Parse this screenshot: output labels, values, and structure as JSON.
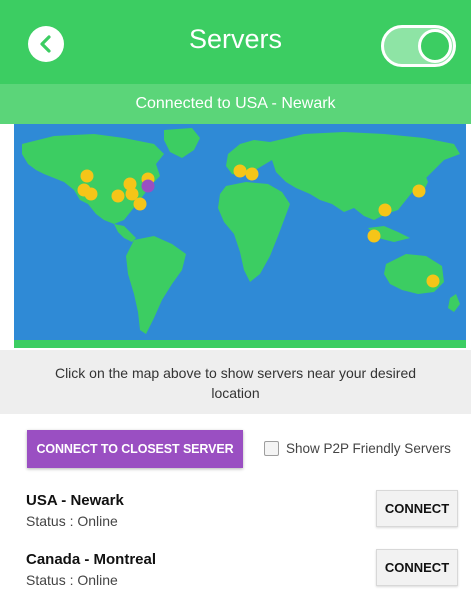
{
  "header": {
    "title": "Servers",
    "back_icon": "chevron-left-icon",
    "vpn_toggle_on": true
  },
  "banner": {
    "text": "Connected to USA - Newark"
  },
  "map": {
    "ocean_color": "#2f8ad6",
    "land_color": "#3ccd62",
    "server_color": "#f5c518",
    "connected_color": "#9a4fc2"
  },
  "hint": {
    "text": "Click on the map above to show servers near your desired location"
  },
  "actions": {
    "closest_label": "CONNECT TO CLOSEST SERVER",
    "p2p_label": "Show P2P Friendly Servers",
    "p2p_checked": false
  },
  "servers": [
    {
      "name": "USA - Newark",
      "status": "Status : Online",
      "button": "CONNECT"
    },
    {
      "name": "Canada - Montreal",
      "status": "Status : Online",
      "button": "CONNECT"
    }
  ],
  "colors": {
    "header_green": "#3ccd62",
    "banner_green": "#5bd579",
    "accent_purple": "#9a4fc2"
  }
}
